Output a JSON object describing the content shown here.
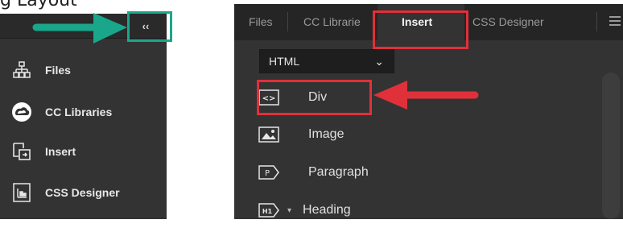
{
  "cropped_heading": "g Layout",
  "left_panel": {
    "collapse_label": "‹‹",
    "items": [
      {
        "label": "Files",
        "icon": "files-tree-icon"
      },
      {
        "label": "CC Libraries",
        "icon": "cc-libraries-icon"
      },
      {
        "label": "Insert",
        "icon": "insert-icon"
      },
      {
        "label": "CSS Designer",
        "icon": "css-designer-icon"
      }
    ]
  },
  "right_panel": {
    "tabs": [
      {
        "label": "Files"
      },
      {
        "label": "CC Librarie"
      },
      {
        "label": "Insert",
        "active": true
      },
      {
        "label": "CSS Designer"
      }
    ],
    "category": {
      "value": "HTML",
      "chevron": "⌄"
    },
    "items": [
      {
        "label": "Div",
        "icon": "div-tag-icon"
      },
      {
        "label": "Image",
        "icon": "image-icon"
      },
      {
        "label": "Paragraph",
        "icon": "paragraph-icon"
      },
      {
        "label": "Heading",
        "icon": "heading-icon"
      }
    ],
    "div_icon_text": "<>",
    "paragraph_icon_text": "P",
    "heading_icon_text": "H1"
  },
  "colors": {
    "panel_bg": "#333333",
    "tab_bar_bg": "#252525",
    "highlight_red": "#e0303a",
    "highlight_teal": "#1aa68a"
  }
}
